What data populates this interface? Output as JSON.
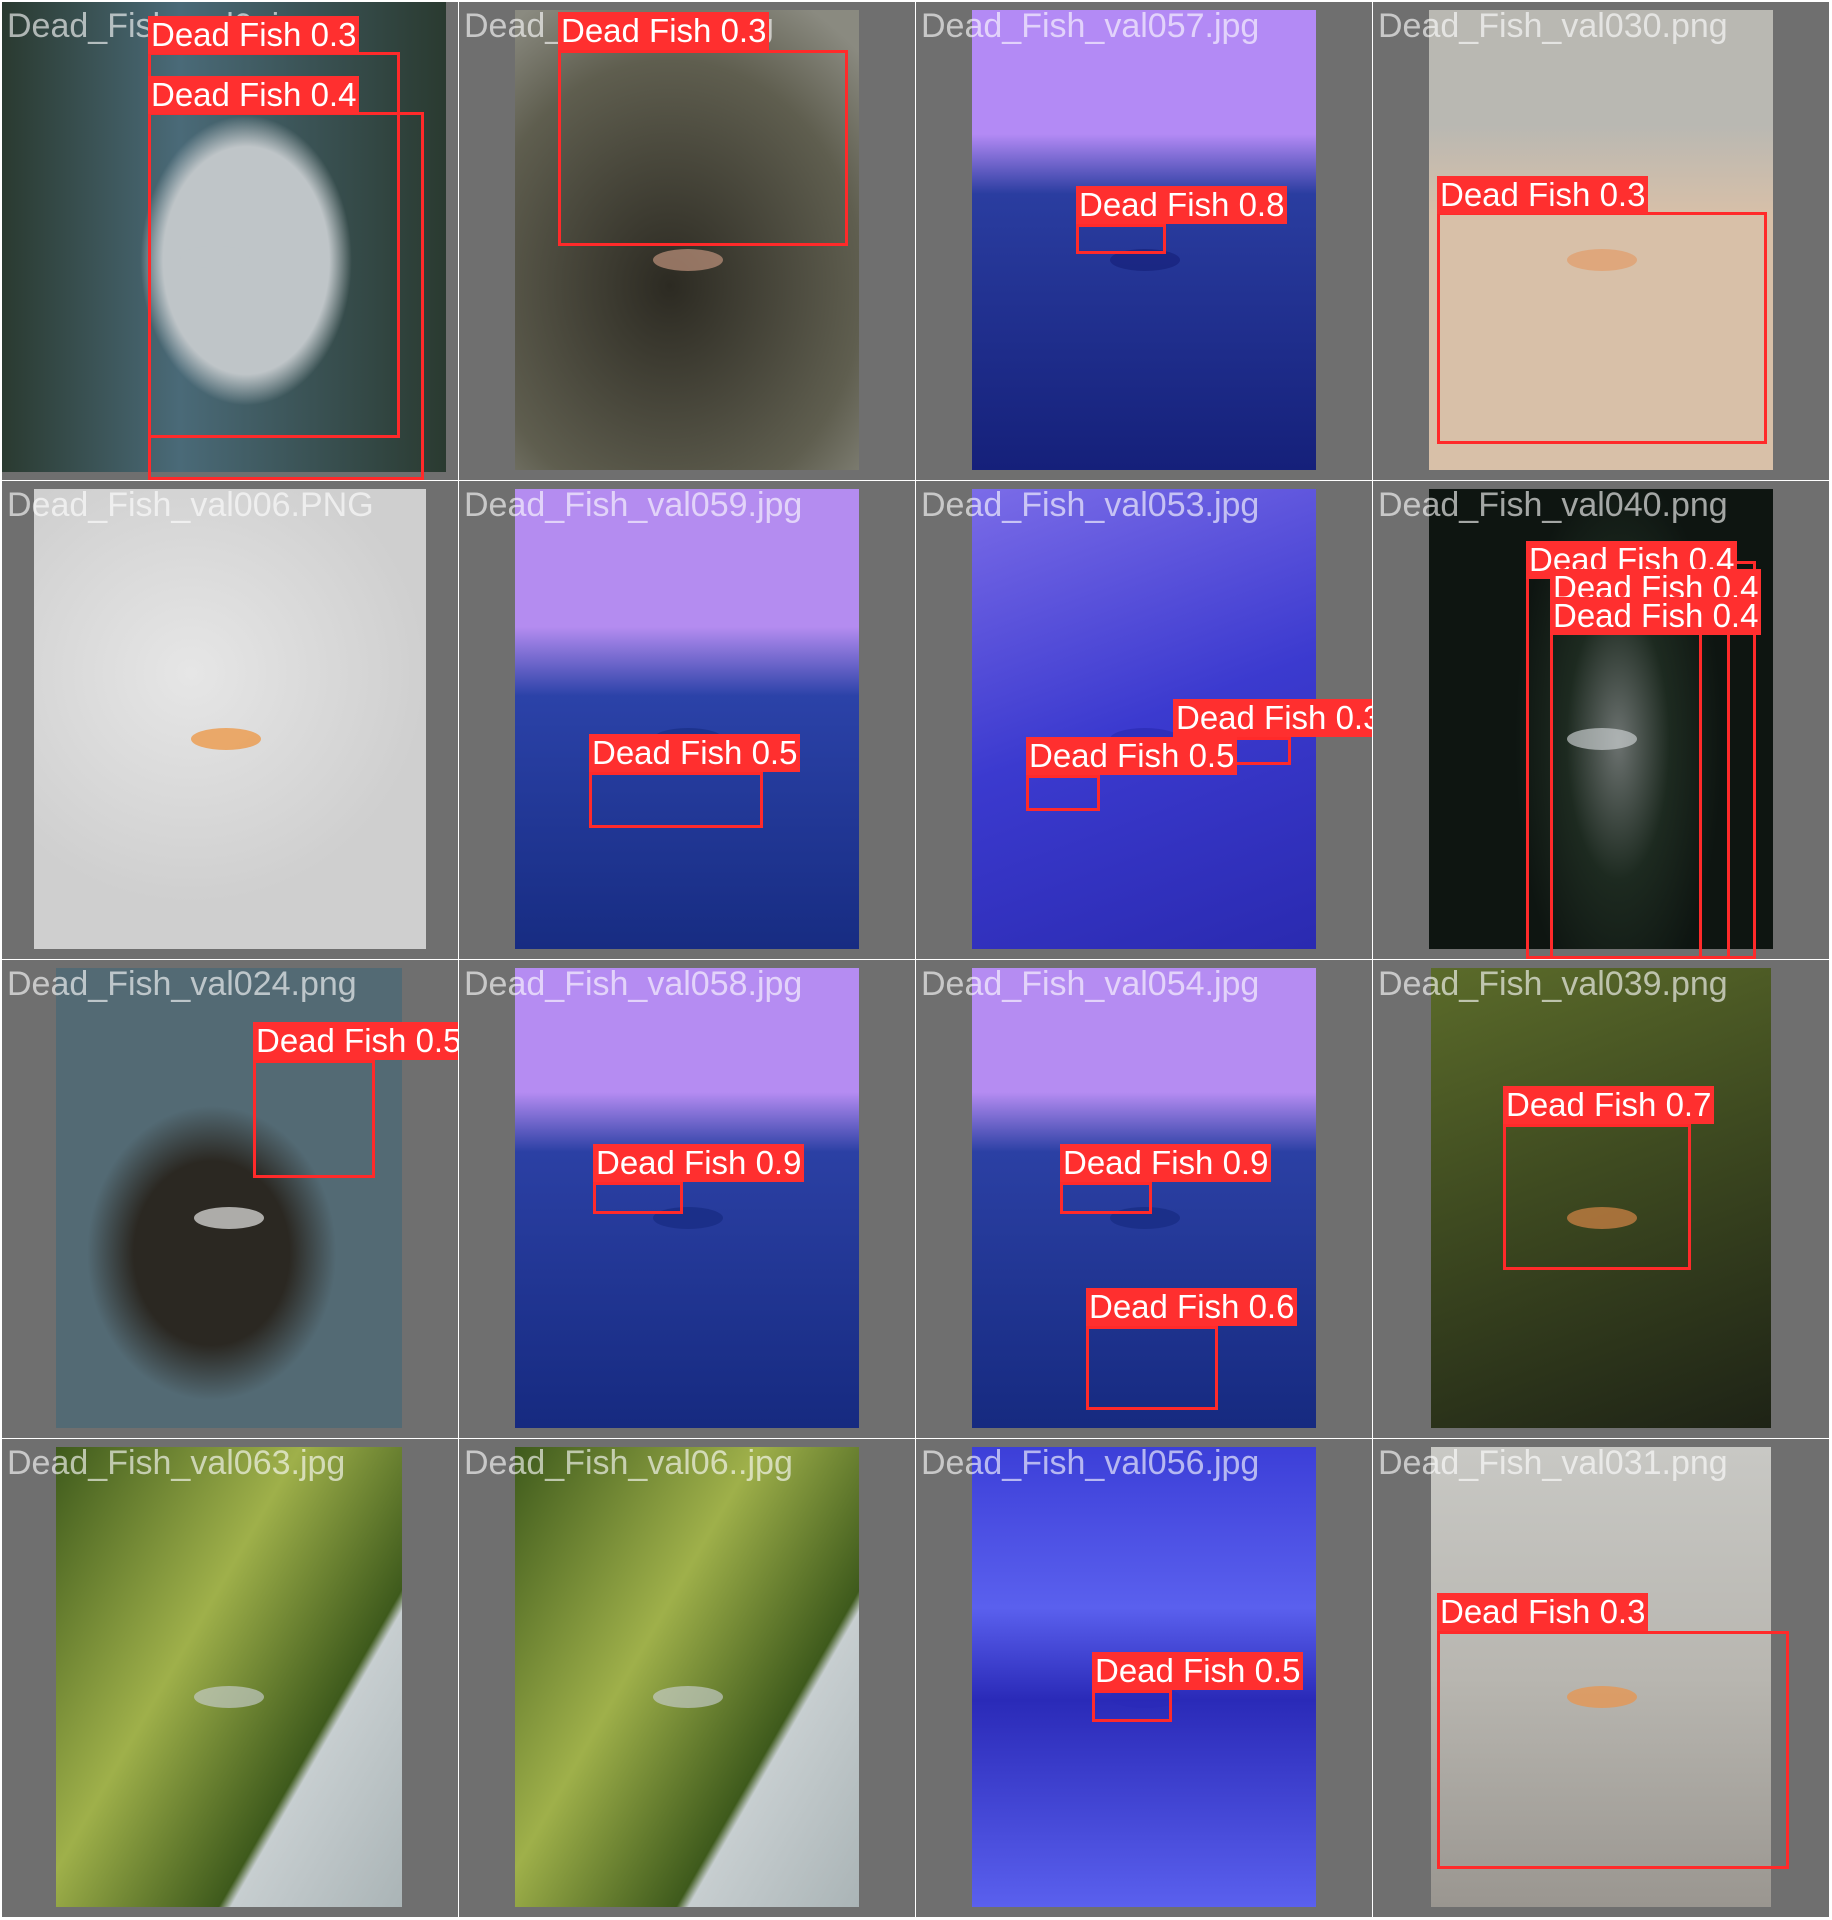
{
  "grid": {
    "background": "#ffffff",
    "tile_background": "#6f6f6f",
    "box_color": "#ff2a2a",
    "label_color": "#ff2f2f",
    "label_text_color": "#ffffff"
  },
  "tiles": [
    {
      "file": "Dead_Fish_val0..jpg",
      "photo_colors": [
        "#4a6a78",
        "#2a3a30",
        "#bfc5c8"
      ],
      "detections": [
        {
          "label": "Dead Fish 0.3"
        },
        {
          "label": "Dead Fish 0.4"
        }
      ]
    },
    {
      "file": "Dead_Fish_val0..jpg",
      "photo_colors": [
        "#5f5e4f",
        "#2c2a22",
        "#c99a83"
      ],
      "detections": [
        {
          "label": "Dead Fish 0.3"
        }
      ]
    },
    {
      "file": "Dead_Fish_val057.jpg",
      "photo_colors": [
        "#b38af5",
        "#2a3da0",
        "#15207a"
      ],
      "detections": [
        {
          "label": "Dead Fish 0.8"
        }
      ]
    },
    {
      "file": "Dead_Fish_val030.png",
      "photo_colors": [
        "#b9b8b2",
        "#d8c0a8",
        "#e49a64"
      ],
      "detections": [
        {
          "label": "Dead Fish 0.3"
        }
      ]
    },
    {
      "file": "Dead_Fish_val006.PNG",
      "photo_colors": [
        "#e6e6e6",
        "#1f6b48",
        "#f08a2a"
      ],
      "detections": []
    },
    {
      "file": "Dead_Fish_val059.jpg",
      "photo_colors": [
        "#b48cf0",
        "#2b42a8",
        "#172c82"
      ],
      "detections": [
        {
          "label": "Dead Fish 0.5"
        }
      ]
    },
    {
      "file": "Dead_Fish_val053.jpg",
      "photo_colors": [
        "#7b6ce8",
        "#3b3acf",
        "#2a2ab0"
      ],
      "detections": [
        {
          "label": "Dead Fish 0.3"
        },
        {
          "label": "Dead Fish 0.5"
        }
      ]
    },
    {
      "file": "Dead_Fish_val040.png",
      "photo_colors": [
        "#1d2a20",
        "#0e1511",
        "#cfd4d6"
      ],
      "detections": [
        {
          "label": "Dead Fish 0.4"
        },
        {
          "label": "Dead Fish 0.4"
        },
        {
          "label": "Dead Fish 0.4"
        }
      ]
    },
    {
      "file": "Dead_Fish_val024.png",
      "photo_colors": [
        "#536a74",
        "#2b2822",
        "#f3f3f3"
      ],
      "detections": [
        {
          "label": "Dead Fish 0.5"
        }
      ]
    },
    {
      "file": "Dead_Fish_val058.jpg",
      "photo_colors": [
        "#b58cf2",
        "#2b40a4",
        "#162a80"
      ],
      "detections": [
        {
          "label": "Dead Fish 0.9"
        }
      ]
    },
    {
      "file": "Dead_Fish_val054.jpg",
      "photo_colors": [
        "#b58cf2",
        "#2b40a4",
        "#162a80"
      ],
      "detections": [
        {
          "label": "Dead Fish 0.9"
        },
        {
          "label": "Dead Fish 0.6"
        }
      ]
    },
    {
      "file": "Dead_Fish_val039.png",
      "photo_colors": [
        "#5b6b2a",
        "#1e2316",
        "#e08a4a"
      ],
      "detections": [
        {
          "label": "Dead Fish 0.7"
        }
      ]
    },
    {
      "file": "Dead_Fish_val063.jpg",
      "photo_colors": [
        "#9fb04a",
        "#3e5a1c",
        "#c7ced0"
      ],
      "detections": []
    },
    {
      "file": "Dead_Fish_val06..jpg",
      "photo_colors": [
        "#9fb04a",
        "#3e5a1c",
        "#c7ced0"
      ],
      "detections": []
    },
    {
      "file": "Dead_Fish_val056.jpg",
      "photo_colors": [
        "#3c3fd8",
        "#5a60ee",
        "#2a2ab8"
      ],
      "detections": [
        {
          "label": "Dead Fish 0.5"
        }
      ]
    },
    {
      "file": "Dead_Fish_val031.png",
      "photo_colors": [
        "#c8c8c4",
        "#b8b6b0",
        "#f09040"
      ],
      "detections": [
        {
          "label": "Dead Fish 0.3"
        }
      ]
    }
  ]
}
